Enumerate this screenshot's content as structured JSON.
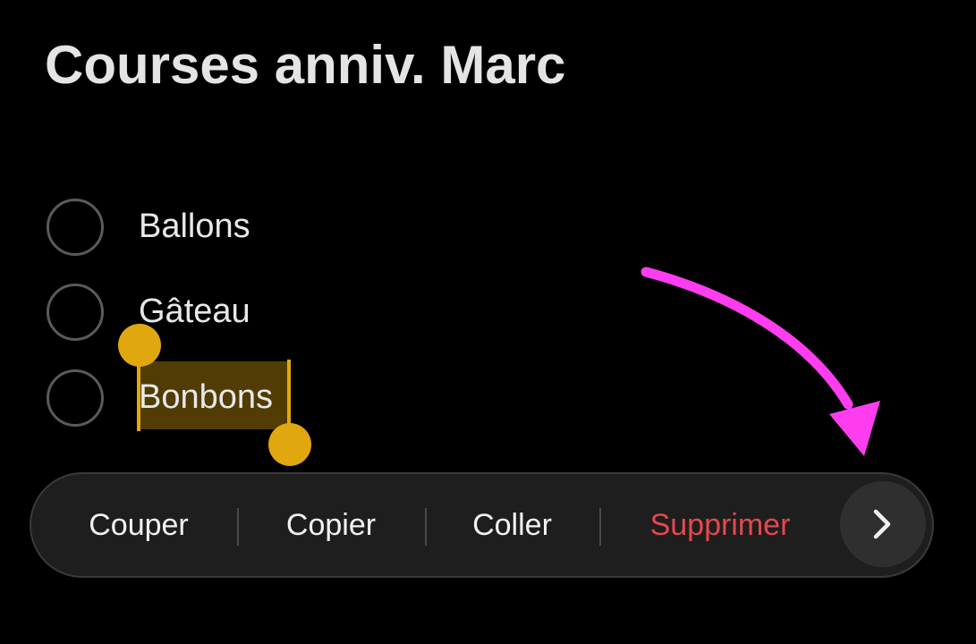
{
  "note": {
    "title": "Courses anniv. Marc",
    "items": [
      {
        "label": "Ballons",
        "checked": false
      },
      {
        "label": "Gâteau",
        "checked": false
      },
      {
        "label": "Bonbons",
        "checked": false,
        "selected": true
      }
    ]
  },
  "edit_menu": {
    "cut_label": "Couper",
    "copy_label": "Copier",
    "paste_label": "Coller",
    "delete_label": "Supprimer",
    "more_icon": "chevron-right-icon"
  },
  "colors": {
    "background": "#000000",
    "selection_handle": "#e0a80e",
    "delete_text": "#e5484d",
    "annotation_arrow": "#ff3df0"
  }
}
